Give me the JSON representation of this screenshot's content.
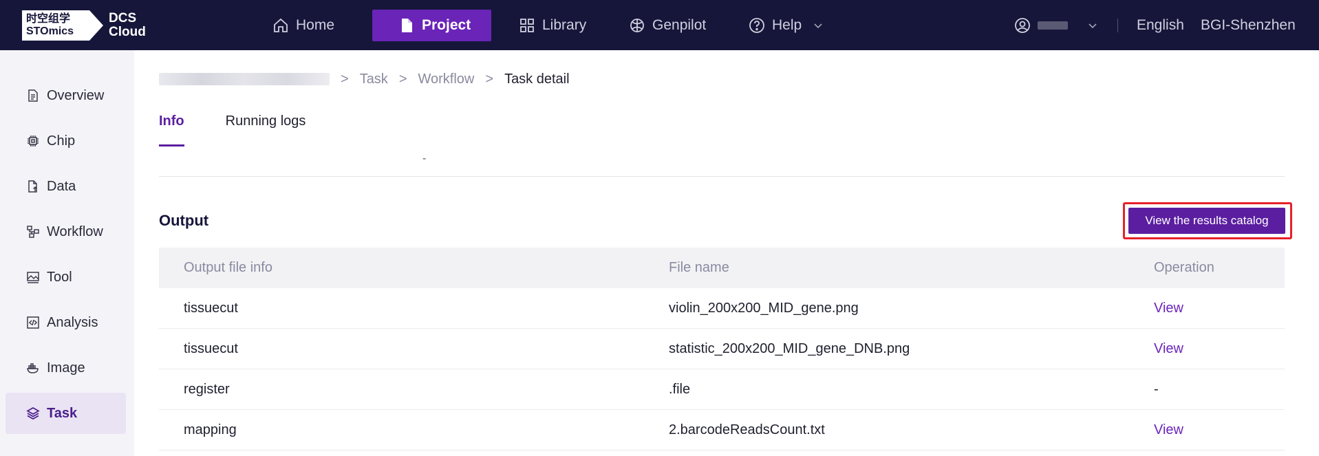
{
  "brand": {
    "logo_cn": "时空组学",
    "logo_en": "STOmics",
    "product_line1": "DCS",
    "product_line2": "Cloud"
  },
  "topnav": {
    "items": [
      {
        "label": "Home",
        "icon": "home-icon"
      },
      {
        "label": "Project",
        "icon": "file-icon",
        "active": true
      },
      {
        "label": "Library",
        "icon": "grid-icon"
      },
      {
        "label": "Genpilot",
        "icon": "globe-icon"
      },
      {
        "label": "Help",
        "icon": "help-circle-icon"
      }
    ],
    "language": "English",
    "region": "BGI-Shenzhen"
  },
  "sidebar": {
    "items": [
      {
        "label": "Overview",
        "icon": "document-icon"
      },
      {
        "label": "Chip",
        "icon": "chip-icon"
      },
      {
        "label": "Data",
        "icon": "file-upload-icon"
      },
      {
        "label": "Workflow",
        "icon": "workflow-icon"
      },
      {
        "label": "Tool",
        "icon": "image-tool-icon"
      },
      {
        "label": "Analysis",
        "icon": "code-icon"
      },
      {
        "label": "Image",
        "icon": "docker-icon"
      },
      {
        "label": "Task",
        "icon": "layers-icon",
        "active": true
      }
    ]
  },
  "breadcrumb": {
    "items": [
      "Task",
      "Workflow"
    ],
    "current": "Task detail",
    "separator": ">"
  },
  "tabs": [
    "Info",
    "Running logs"
  ],
  "info": {
    "dash": "-"
  },
  "output": {
    "title": "Output",
    "button_label": "View the results catalog",
    "columns": [
      "Output file info",
      "File name",
      "Operation"
    ],
    "rows": [
      {
        "info": "tissuecut",
        "file": "violin_200x200_MID_gene.png",
        "op": "View"
      },
      {
        "info": "tissuecut",
        "file": "statistic_200x200_MID_gene_DNB.png",
        "op": "View"
      },
      {
        "info": "register",
        "file": ".file",
        "op": "-"
      },
      {
        "info": "mapping",
        "file": "2.barcodeReadsCount.txt",
        "op": "View"
      }
    ]
  },
  "colors": {
    "nav_bg": "#16163a",
    "accent": "#5b1ea0",
    "highlight": "#e8202a"
  }
}
